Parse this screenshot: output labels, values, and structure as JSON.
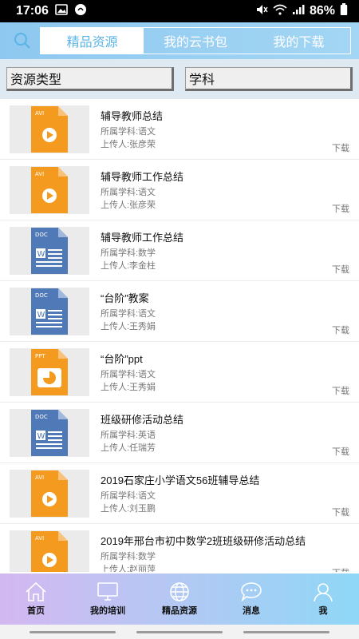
{
  "status_bar": {
    "time": "17:06",
    "battery": "86%"
  },
  "header": {
    "tabs": [
      {
        "label": "精品资源",
        "active": true
      },
      {
        "label": "我的云书包",
        "active": false
      },
      {
        "label": "我的下载",
        "active": false
      }
    ]
  },
  "filters": {
    "type_label": "资源类型",
    "subject_label": "学科"
  },
  "resources": [
    {
      "file_type": "AVI",
      "title": "辅导教师总结",
      "subject": "所属学科:语文",
      "uploader": "上传人:张彦荣",
      "action": "下载"
    },
    {
      "file_type": "AVI",
      "title": "辅导教师工作总结",
      "subject": "所属学科:语文",
      "uploader": "上传人:张彦荣",
      "action": "下载"
    },
    {
      "file_type": "DOC",
      "title": "辅导教师工作总结",
      "subject": "所属学科:数学",
      "uploader": "上传人:李金柱",
      "action": "下载"
    },
    {
      "file_type": "DOC",
      "title": "“台阶”教案",
      "subject": "所属学科:语文",
      "uploader": "上传人:王秀娟",
      "action": "下载"
    },
    {
      "file_type": "PPT",
      "title": "“台阶”ppt",
      "subject": "所属学科:语文",
      "uploader": "上传人:王秀娟",
      "action": "下载"
    },
    {
      "file_type": "DOC",
      "title": "班级研修活动总结",
      "subject": "所属学科:英语",
      "uploader": "上传人:任瑞芳",
      "action": "下载"
    },
    {
      "file_type": "AVI",
      "title": "2019石家庄小学语文56班辅导总结",
      "subject": "所属学科:语文",
      "uploader": "上传人:刘玉鹏",
      "action": "下载"
    },
    {
      "file_type": "AVI",
      "title": "2019年邢台市初中数学2班班级研修活动总结",
      "subject": "所属学科:数学",
      "uploader": "上传人:赵丽萍",
      "action": "下载"
    }
  ],
  "bottom_nav": [
    {
      "label": "首页",
      "icon": "home-icon"
    },
    {
      "label": "我的培训",
      "icon": "monitor-icon"
    },
    {
      "label": "精品资源",
      "icon": "globe-icon"
    },
    {
      "label": "消息",
      "icon": "chat-icon"
    },
    {
      "label": "我",
      "icon": "user-icon"
    }
  ],
  "colors": {
    "avi_orange": "#f39a1f",
    "doc_blue": "#4f79b7",
    "ppt_orange": "#f39a1f",
    "header_blue": "#8ec8f0"
  }
}
